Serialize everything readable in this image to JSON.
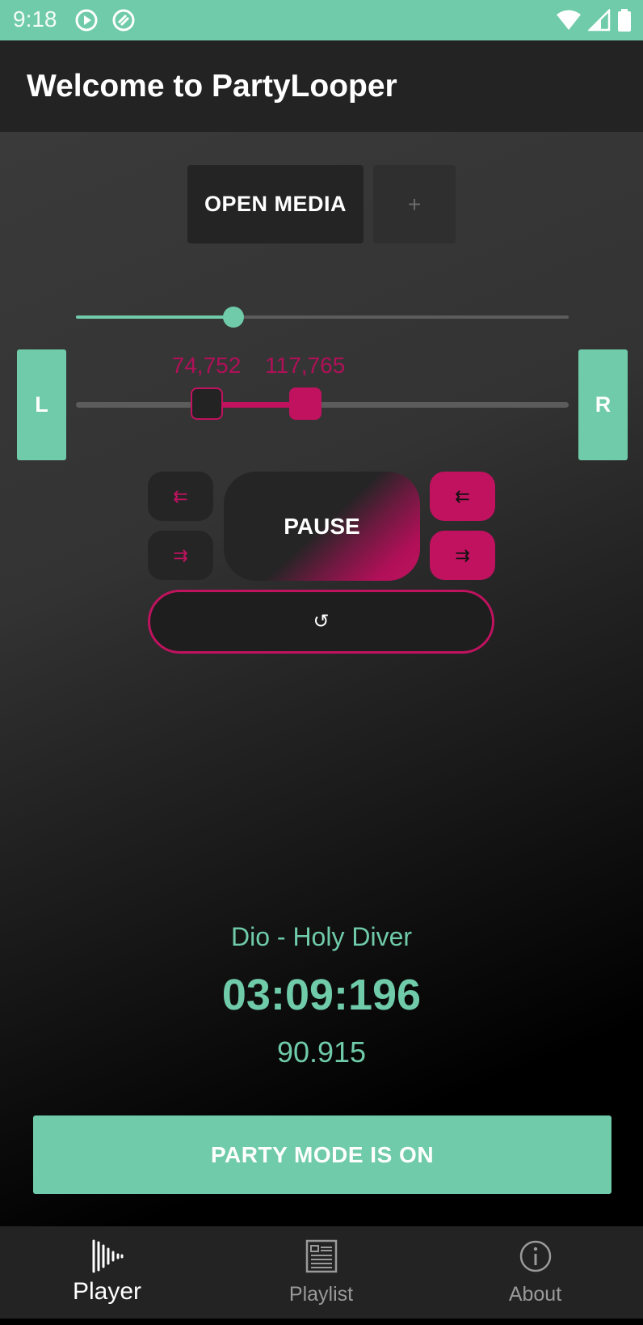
{
  "status_bar": {
    "time": "9:18",
    "icons": [
      "play-circle-icon",
      "sync-icon",
      "wifi-icon",
      "signal-icon",
      "battery-icon"
    ]
  },
  "app_bar": {
    "title": "Welcome to PartyLooper"
  },
  "media_controls": {
    "open_media_label": "OPEN MEDIA",
    "add_label": "+"
  },
  "seek": {
    "progress_fraction": 0.32
  },
  "loop_range": {
    "start_label": "74,752",
    "end_label": "117,765",
    "start_fraction": 0.265,
    "end_fraction": 0.465
  },
  "side_buttons": {
    "left_label": "L",
    "right_label": "R"
  },
  "transport": {
    "pause_label": "PAUSE",
    "start_back_glyph": "⇇",
    "start_forward_glyph": "⇉",
    "end_back_glyph": "⇇",
    "end_forward_glyph": "⇉",
    "reset_glyph": "↺"
  },
  "now_playing": {
    "title": "Dio - Holy Diver",
    "time": "03:09:196",
    "bpm": "90.915"
  },
  "party_mode": {
    "label": "PARTY MODE IS ON"
  },
  "bottom_nav": {
    "items": [
      {
        "label": "Player",
        "icon": "waveform-icon",
        "active": true
      },
      {
        "label": "Playlist",
        "icon": "playlist-icon",
        "active": false
      },
      {
        "label": "About",
        "icon": "info-icon",
        "active": false
      }
    ]
  },
  "colors": {
    "accent_green": "#6fcba9",
    "accent_pink": "#c0125f",
    "bar_dark": "#232323"
  }
}
